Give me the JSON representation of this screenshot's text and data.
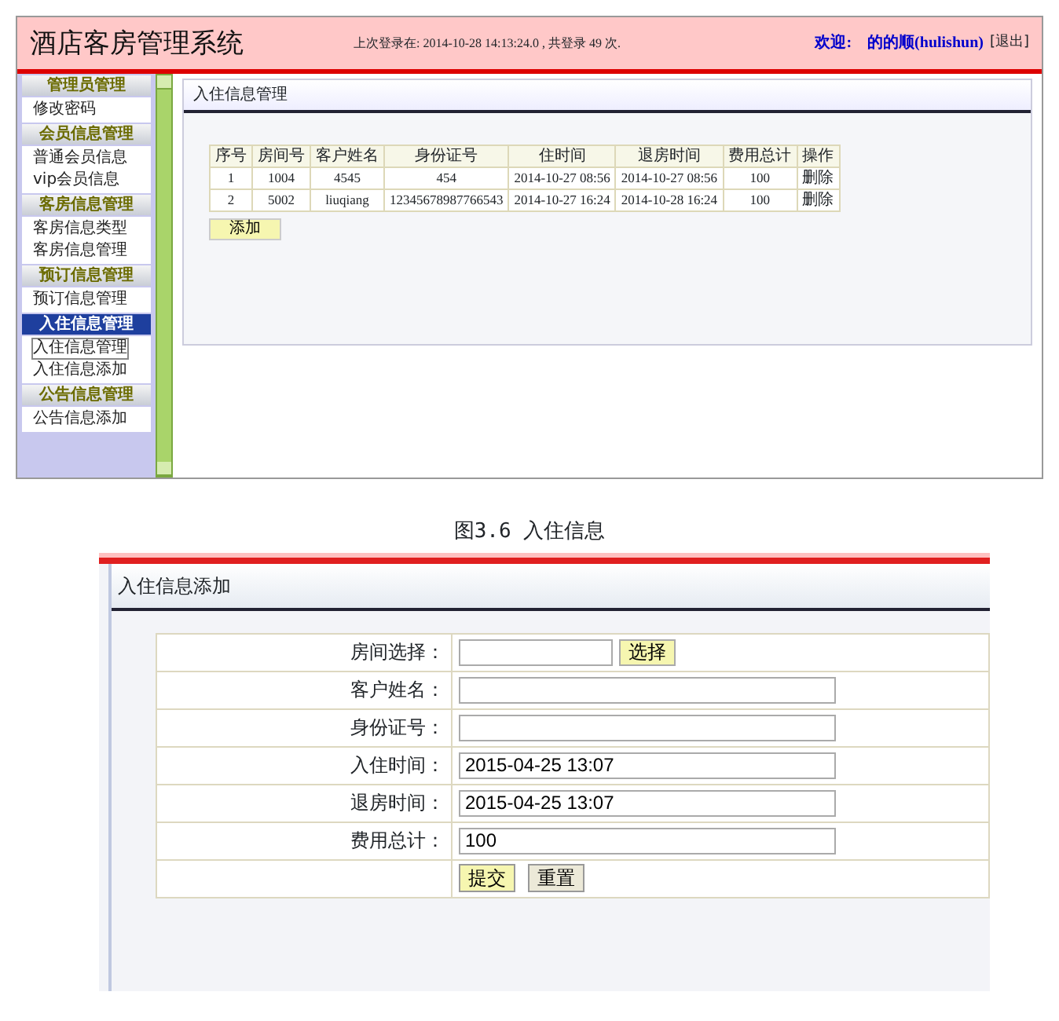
{
  "app": {
    "title": "酒店客房管理系统",
    "last_login": "上次登录在: 2014-10-28 14:13:24.0 , 共登录  49 次.",
    "welcome": "欢迎:",
    "user": "的的顺(hulishun)",
    "logout": "[退出]"
  },
  "sidebar": [
    {
      "heading": "管理员管理",
      "selected": false,
      "items": [
        {
          "label": "修改密码",
          "focused": false
        }
      ]
    },
    {
      "heading": "会员信息管理",
      "selected": false,
      "items": [
        {
          "label": "普通会员信息",
          "focused": false
        },
        {
          "label": "vip会员信息",
          "focused": false
        }
      ]
    },
    {
      "heading": "客房信息管理",
      "selected": false,
      "items": [
        {
          "label": "客房信息类型",
          "focused": false
        },
        {
          "label": "客房信息管理",
          "focused": false
        }
      ]
    },
    {
      "heading": "预订信息管理",
      "selected": false,
      "items": [
        {
          "label": "预订信息管理",
          "focused": false
        }
      ]
    },
    {
      "heading": "入住信息管理",
      "selected": true,
      "items": [
        {
          "label": "入住信息管理",
          "focused": true
        },
        {
          "label": "入住信息添加",
          "focused": false
        }
      ]
    },
    {
      "heading": "公告信息管理",
      "selected": false,
      "items": [
        {
          "label": "公告信息添加",
          "focused": false
        }
      ]
    }
  ],
  "list_panel": {
    "title": "入住信息管理",
    "columns": [
      "序号",
      "房间号",
      "客户姓名",
      "身份证号",
      "住时间",
      "退房时间",
      "费用总计",
      "操作"
    ],
    "rows": [
      [
        "1",
        "1004",
        "4545",
        "454",
        "2014-10-27 08:56",
        "2014-10-27 08:56",
        "100",
        "删除"
      ],
      [
        "2",
        "5002",
        "liuqiang",
        "12345678987766543",
        "2014-10-27 16:24",
        "2014-10-28 16:24",
        "100",
        "删除"
      ]
    ],
    "add_button": "添加"
  },
  "caption": "图3.6 入住信息",
  "form_panel": {
    "title": "入住信息添加",
    "fields": [
      {
        "label": "房间选择：",
        "kind": "pick",
        "button": "选择"
      },
      {
        "label": "客户姓名：",
        "kind": "text"
      },
      {
        "label": "身份证号：",
        "kind": "text"
      },
      {
        "label": "入住时间：",
        "kind": "text",
        "value": "2015-04-25 13:07"
      },
      {
        "label": "退房时间：",
        "kind": "text",
        "value": "2015-04-25 13:07"
      },
      {
        "label": "费用总计：",
        "kind": "text",
        "value": "100"
      }
    ],
    "buttons": [
      "提交",
      "重置"
    ]
  }
}
